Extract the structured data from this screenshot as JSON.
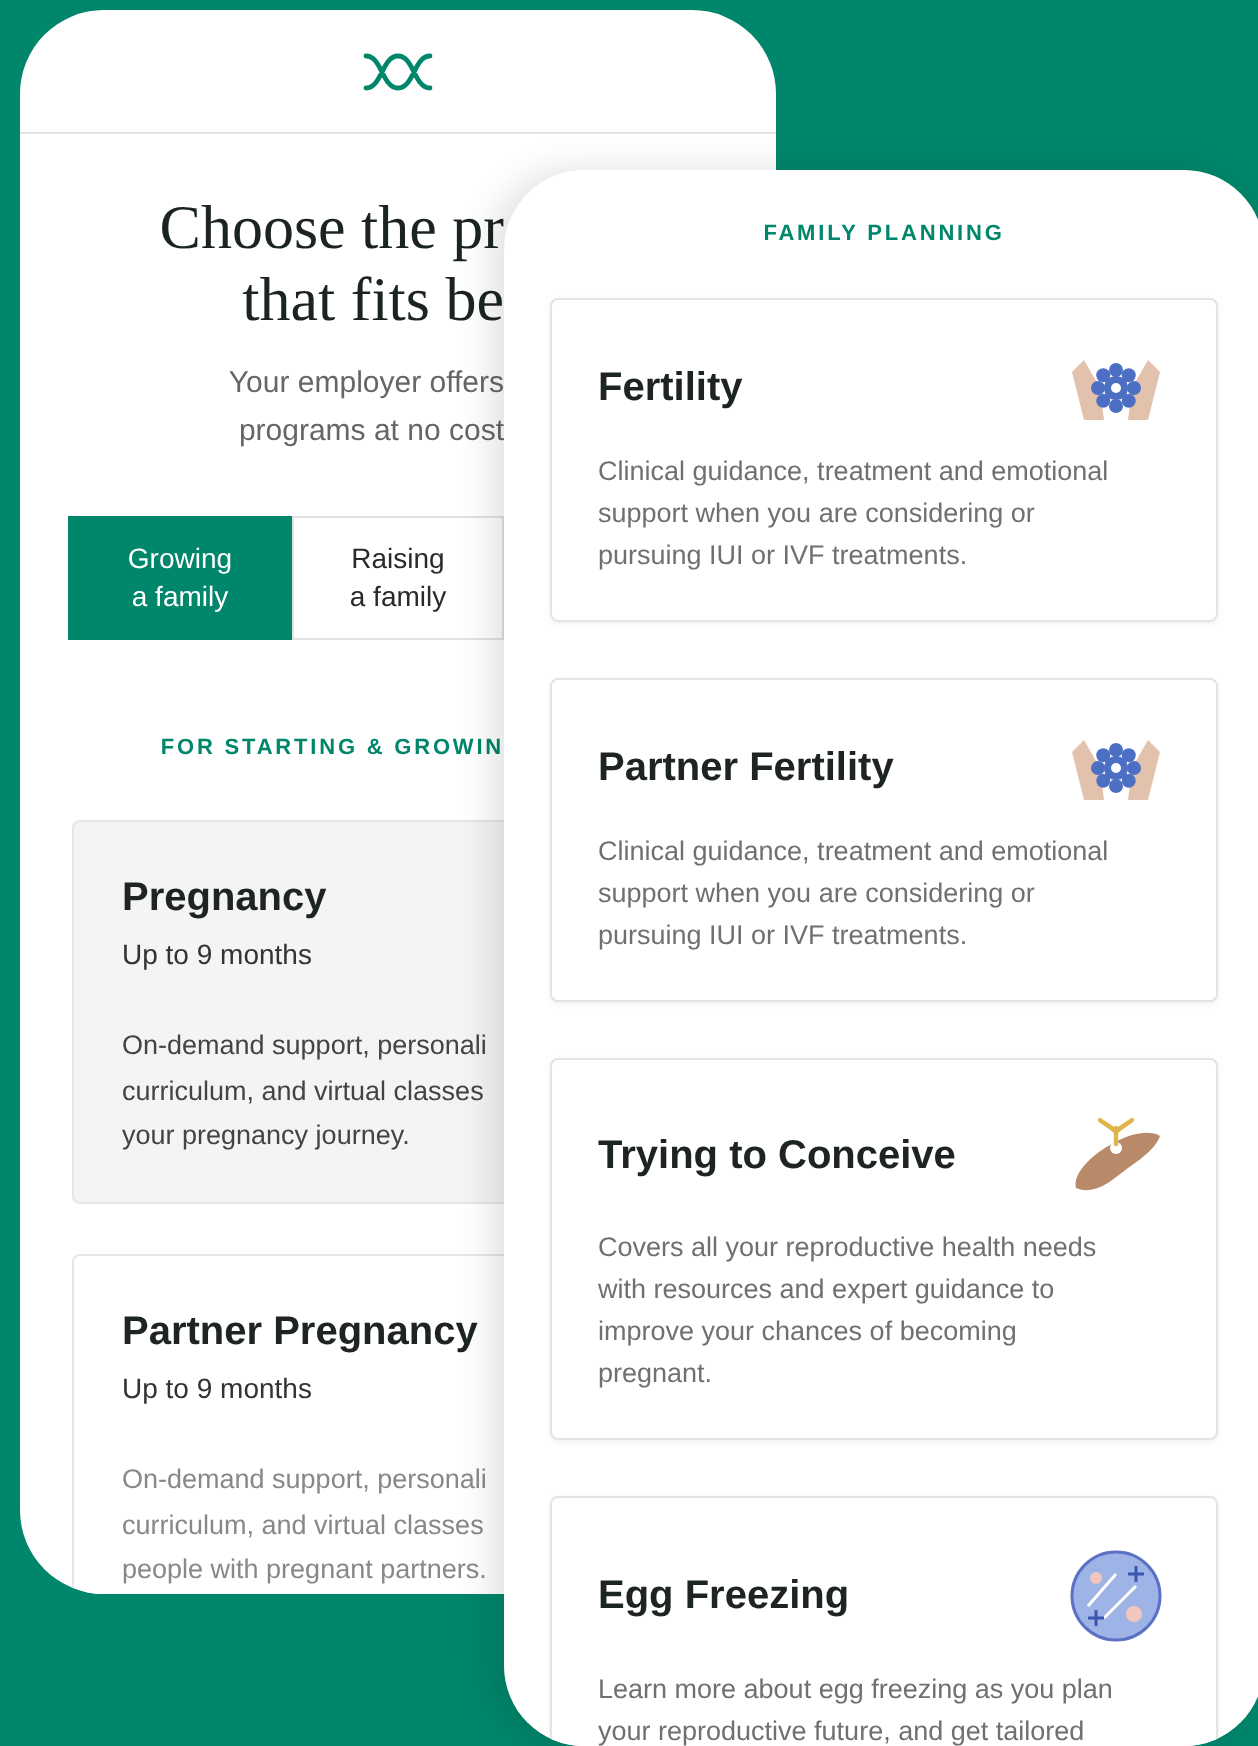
{
  "back_phone": {
    "title_lines": [
      "Choose the pr",
      "that fits be"
    ],
    "intro_lines": [
      "Your employer offers",
      "programs at no cost"
    ],
    "tabs": [
      {
        "label": "Growing a family",
        "selected": true
      },
      {
        "label": "Raising a family",
        "selected": false
      }
    ],
    "section_label": "FOR STARTING & GROWIN",
    "cards": [
      {
        "title": "Pregnancy",
        "duration": "Up to 9 months",
        "lines": [
          "On-demand support, personali",
          "curriculum, and virtual classes",
          "your pregnancy journey."
        ],
        "selected": true
      },
      {
        "title": "Partner Pregnancy",
        "duration": "Up to 9 months",
        "lines": [
          "On-demand support, personali",
          "curriculum, and virtual classes",
          "people with pregnant partners."
        ],
        "selected": false
      }
    ]
  },
  "front_phone": {
    "section_label": "FAMILY PLANNING",
    "cards": [
      {
        "title": "Fertility",
        "kind": "hands",
        "description": "Clinical guidance, treatment and emotional support when you are considering or pursuing IUI or IVF treatments."
      },
      {
        "title": "Partner Fertility",
        "kind": "hands",
        "description": "Clinical guidance, treatment and emotional support when you are considering or pursuing IUI or IVF treatments."
      },
      {
        "title": "Trying to Conceive",
        "kind": "sprout",
        "description": "Covers all your reproductive health needs with resources and expert guidance to improve your chances of becoming pregnant."
      },
      {
        "title": "Egg Freezing",
        "kind": "disc",
        "description": "Learn more about egg freezing as you plan your reproductive future, and get tailored"
      }
    ]
  }
}
